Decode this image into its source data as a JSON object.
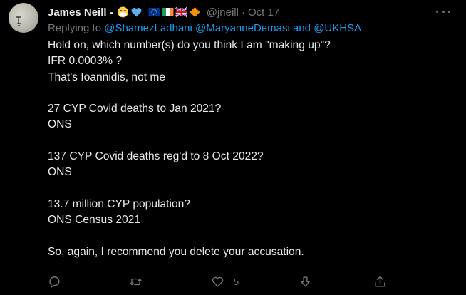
{
  "author": {
    "name": "James Neill -",
    "handle": "@jneill",
    "separator": "·",
    "date": "Oct 17",
    "emojis": [
      "face-with-medical-mask",
      "blue-heart",
      "eu-flag",
      "ireland-flag",
      "uk-flag",
      "orange-diamond"
    ]
  },
  "reply": {
    "prefix": "Replying to",
    "mention1": "@ShamezLadhani",
    "mention2": "@MaryanneDemasi",
    "conjunction": "and",
    "mention3": "@UKHSA"
  },
  "body": {
    "line1": "Hold on, which number(s) do you think I am \"making up\"?",
    "line2": "IFR 0.0003% ?",
    "line3": "That's Ioannidis, not me",
    "line4": "27 CYP Covid deaths to Jan 2021?",
    "line5": "ONS",
    "line6": "137 CYP Covid deaths reg'd to 8 Oct 2022?",
    "line7": "ONS",
    "line8": "13.7 million CYP population?",
    "line9": "ONS Census 2021",
    "line10": "So, again, I recommend you delete your accusation."
  },
  "actions": {
    "reply_icon": "comment-icon",
    "retweet_icon": "retweet-icon",
    "like_icon": "heart-icon",
    "like_count": "5",
    "downvote_icon": "arrow-down-icon",
    "share_icon": "share-icon"
  },
  "colors": {
    "background": "#000000",
    "text": "#e7e9ea",
    "muted": "#71767b",
    "link": "#1d9bf0"
  }
}
